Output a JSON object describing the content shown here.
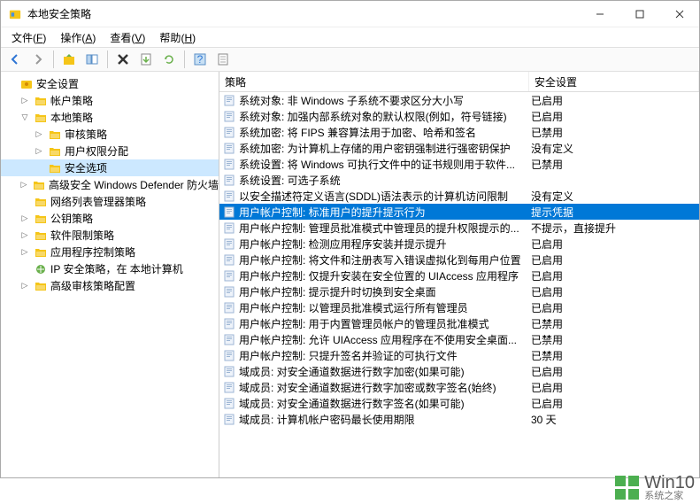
{
  "window": {
    "title": "本地安全策略"
  },
  "menubar": [
    {
      "label": "文件",
      "accel": "F"
    },
    {
      "label": "操作",
      "accel": "A"
    },
    {
      "label": "查看",
      "accel": "V"
    },
    {
      "label": "帮助",
      "accel": "H"
    }
  ],
  "tree": {
    "root": {
      "label": "安全设置"
    },
    "items": [
      {
        "indent": 1,
        "exp": "▷",
        "icon": "folder",
        "label": "帐户策略"
      },
      {
        "indent": 1,
        "exp": "▽",
        "icon": "folder",
        "label": "本地策略"
      },
      {
        "indent": 2,
        "exp": "▷",
        "icon": "folder",
        "label": "审核策略"
      },
      {
        "indent": 2,
        "exp": "▷",
        "icon": "folder",
        "label": "用户权限分配"
      },
      {
        "indent": 2,
        "exp": "",
        "icon": "folder",
        "label": "安全选项",
        "selected": true
      },
      {
        "indent": 1,
        "exp": "▷",
        "icon": "folder",
        "label": "高级安全 Windows Defender 防火墙"
      },
      {
        "indent": 1,
        "exp": "",
        "icon": "folder",
        "label": "网络列表管理器策略"
      },
      {
        "indent": 1,
        "exp": "▷",
        "icon": "folder",
        "label": "公钥策略"
      },
      {
        "indent": 1,
        "exp": "▷",
        "icon": "folder",
        "label": "软件限制策略"
      },
      {
        "indent": 1,
        "exp": "▷",
        "icon": "folder",
        "label": "应用程序控制策略"
      },
      {
        "indent": 1,
        "exp": "",
        "icon": "ip",
        "label": "IP 安全策略，在 本地计算机"
      },
      {
        "indent": 1,
        "exp": "▷",
        "icon": "folder",
        "label": "高级审核策略配置"
      }
    ]
  },
  "list": {
    "headers": {
      "policy": "策略",
      "setting": "安全设置"
    },
    "rows": [
      {
        "policy": "系统对象: 非 Windows 子系统不要求区分大小写",
        "setting": "已启用"
      },
      {
        "policy": "系统对象: 加强内部系统对象的默认权限(例如，符号链接)",
        "setting": "已启用"
      },
      {
        "policy": "系统加密: 将 FIPS 兼容算法用于加密、哈希和签名",
        "setting": "已禁用"
      },
      {
        "policy": "系统加密: 为计算机上存储的用户密钥强制进行强密钥保护",
        "setting": "没有定义"
      },
      {
        "policy": "系统设置: 将 Windows 可执行文件中的证书规则用于软件...",
        "setting": "已禁用"
      },
      {
        "policy": "系统设置: 可选子系统",
        "setting": ""
      },
      {
        "policy": "以安全描述符定义语言(SDDL)语法表示的计算机访问限制",
        "setting": "没有定义"
      },
      {
        "policy": "用户帐户控制: 标准用户的提升提示行为",
        "setting": "提示凭据",
        "selected": true
      },
      {
        "policy": "用户帐户控制: 管理员批准模式中管理员的提升权限提示的...",
        "setting": "不提示，直接提升"
      },
      {
        "policy": "用户帐户控制: 检测应用程序安装并提示提升",
        "setting": "已启用"
      },
      {
        "policy": "用户帐户控制: 将文件和注册表写入错误虚拟化到每用户位置",
        "setting": "已启用"
      },
      {
        "policy": "用户帐户控制: 仅提升安装在安全位置的 UIAccess 应用程序",
        "setting": "已启用"
      },
      {
        "policy": "用户帐户控制: 提示提升时切换到安全桌面",
        "setting": "已启用"
      },
      {
        "policy": "用户帐户控制: 以管理员批准模式运行所有管理员",
        "setting": "已启用"
      },
      {
        "policy": "用户帐户控制: 用于内置管理员帐户的管理员批准模式",
        "setting": "已禁用"
      },
      {
        "policy": "用户帐户控制: 允许 UIAccess 应用程序在不使用安全桌面...",
        "setting": "已禁用"
      },
      {
        "policy": "用户帐户控制: 只提升签名并验证的可执行文件",
        "setting": "已禁用"
      },
      {
        "policy": "域成员: 对安全通道数据进行数字加密(如果可能)",
        "setting": "已启用"
      },
      {
        "policy": "域成员: 对安全通道数据进行数字加密或数字签名(始终)",
        "setting": "已启用"
      },
      {
        "policy": "域成员: 对安全通道数据进行数字签名(如果可能)",
        "setting": "已启用"
      },
      {
        "policy": "域成员: 计算机帐户密码最长使用期限",
        "setting": "30 天"
      }
    ]
  },
  "watermark": {
    "top": "Win10",
    "bottom": "系统之家"
  }
}
